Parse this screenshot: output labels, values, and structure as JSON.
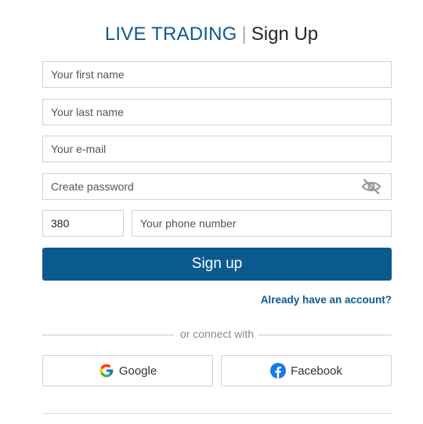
{
  "header": {
    "brand": "LIVE TRADING",
    "separator": "|",
    "action": "Sign Up"
  },
  "form": {
    "first_name_placeholder": "Your first name",
    "last_name_placeholder": "Your last name",
    "email_placeholder": "Your e-mail",
    "password_placeholder": "Create password",
    "password_toggle_icon": "eye-slash-icon",
    "country_code_value": "380",
    "phone_placeholder": "Your phone number",
    "submit_label": "Sign up"
  },
  "login_link": "Already have an account?",
  "divider_text": "or connect with",
  "social": {
    "google_label": "Google",
    "google_icon": "google-icon",
    "facebook_label": "Facebook",
    "facebook_icon": "facebook-icon"
  },
  "colors": {
    "brand": "#0b5a8f",
    "button_bg": "#0b5a8f",
    "border": "#cfd3d7",
    "facebook": "#1877f2"
  }
}
